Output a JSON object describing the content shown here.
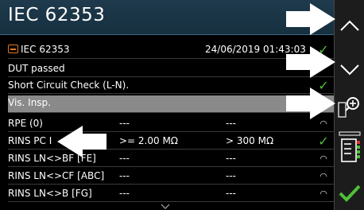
{
  "window": {
    "title": "IEC 62353"
  },
  "header": {
    "test_name": "IEC 62353",
    "date": "24/06/2019 01:43:03"
  },
  "rows": [
    {
      "name": "DUT passed",
      "value": "",
      "limit": "",
      "status": ""
    },
    {
      "name": "Short Circuit Check (L-N).",
      "value": "",
      "limit": "",
      "status": "check"
    },
    {
      "name": "Vis. Insp.",
      "value": "",
      "limit": "",
      "status": ""
    },
    {
      "name": "RPE (0)",
      "value": "---",
      "limit": "---",
      "status": "gauge"
    },
    {
      "name": "RINS PC I",
      "value": ">= 2.00 MΩ",
      "limit": "> 300 MΩ",
      "status": "check"
    },
    {
      "name": "RINS LN<>BF [FE]",
      "value": "---",
      "limit": "---",
      "status": "gauge"
    },
    {
      "name": "RINS LN<>CF [ABC]",
      "value": "---",
      "limit": "---",
      "status": "gauge"
    },
    {
      "name": "RINS LN<>B [FG]",
      "value": "---",
      "limit": "---",
      "status": "gauge"
    }
  ],
  "side_panel": {
    "up": "scroll-up",
    "down": "scroll-down",
    "zoom": "zoom-details",
    "list": "result-list",
    "ok": "confirm"
  },
  "colors": {
    "title_bg": "#1e3a4c",
    "highlight_row": "#8a8a8a",
    "check": "#4fbf3a",
    "folder": "#e07a26"
  }
}
